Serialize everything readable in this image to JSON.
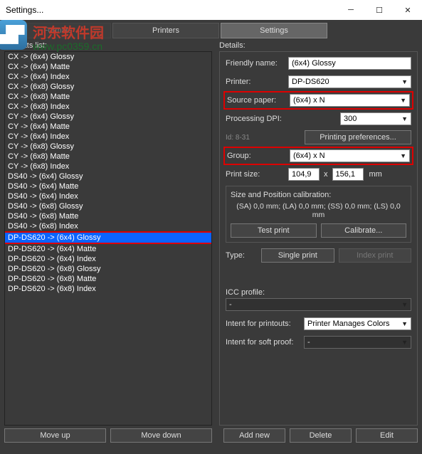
{
  "window": {
    "title": "Settings..."
  },
  "watermark": {
    "cn": "河东软件园",
    "url": "www.pc0359.cn",
    "logo": "▟▛"
  },
  "tabs": {
    "formats": "Formats",
    "printers": "Printers",
    "settings": "Settings"
  },
  "left": {
    "label": "Formats list:",
    "selected_index": 18,
    "items": [
      "CX -> (6x4) Glossy",
      "CX -> (6x4) Matte",
      "CX -> (6x4) Index",
      "CX -> (6x8) Glossy",
      "CX -> (6x8) Matte",
      "CX -> (6x8) Index",
      "CY -> (6x4) Glossy",
      "CY -> (6x4) Matte",
      "CY -> (6x4) Index",
      "CY -> (6x8) Glossy",
      "CY -> (6x8) Matte",
      "CY -> (6x8) Index",
      "DS40 -> (6x4) Glossy",
      "DS40 -> (6x4) Matte",
      "DS40 -> (6x4) Index",
      "DS40 -> (6x8) Glossy",
      "DS40 -> (6x8) Matte",
      "DS40 -> (6x8) Index",
      "DP-DS620 -> (6x4) Glossy",
      "DP-DS620 -> (6x4) Matte",
      "DP-DS620 -> (6x4) Index",
      "DP-DS620 -> (6x8) Glossy",
      "DP-DS620 -> (6x8) Matte",
      "DP-DS620 -> (6x8) Index"
    ]
  },
  "details": {
    "label": "Details:",
    "friendly_name_label": "Friendly name:",
    "friendly_name": "(6x4) Glossy",
    "printer_label": "Printer:",
    "printer": "DP-DS620",
    "source_paper_label": "Source paper:",
    "source_paper": "(6x4) x N",
    "dpi_label": "Processing DPI:",
    "dpi": "300",
    "id_label": "Id: 8-31",
    "pref_btn": "Printing preferences...",
    "group_label": "Group:",
    "group": "(6x4) x N",
    "print_size_label": "Print size:",
    "size_w": "104,9",
    "size_h": "156,1",
    "size_unit": "mm",
    "size_x": "x",
    "calib": {
      "title": "Size and Position calibration:",
      "text": "(SA) 0,0 mm; (LA) 0,0 mm; (SS) 0,0 mm; (LS) 0,0 mm",
      "test": "Test print",
      "calibrate": "Calibrate..."
    },
    "type_label": "Type:",
    "type_single": "Single print",
    "type_index": "Index print",
    "icc_label": "ICC profile:",
    "icc_value": "-",
    "intent_print_label": "Intent for printouts:",
    "intent_print": "Printer Manages Colors",
    "intent_soft_label": "Intent for soft proof:",
    "intent_soft": "-"
  },
  "footer": {
    "move_up": "Move up",
    "move_down": "Move down",
    "add_new": "Add new",
    "delete": "Delete",
    "edit": "Edit"
  }
}
